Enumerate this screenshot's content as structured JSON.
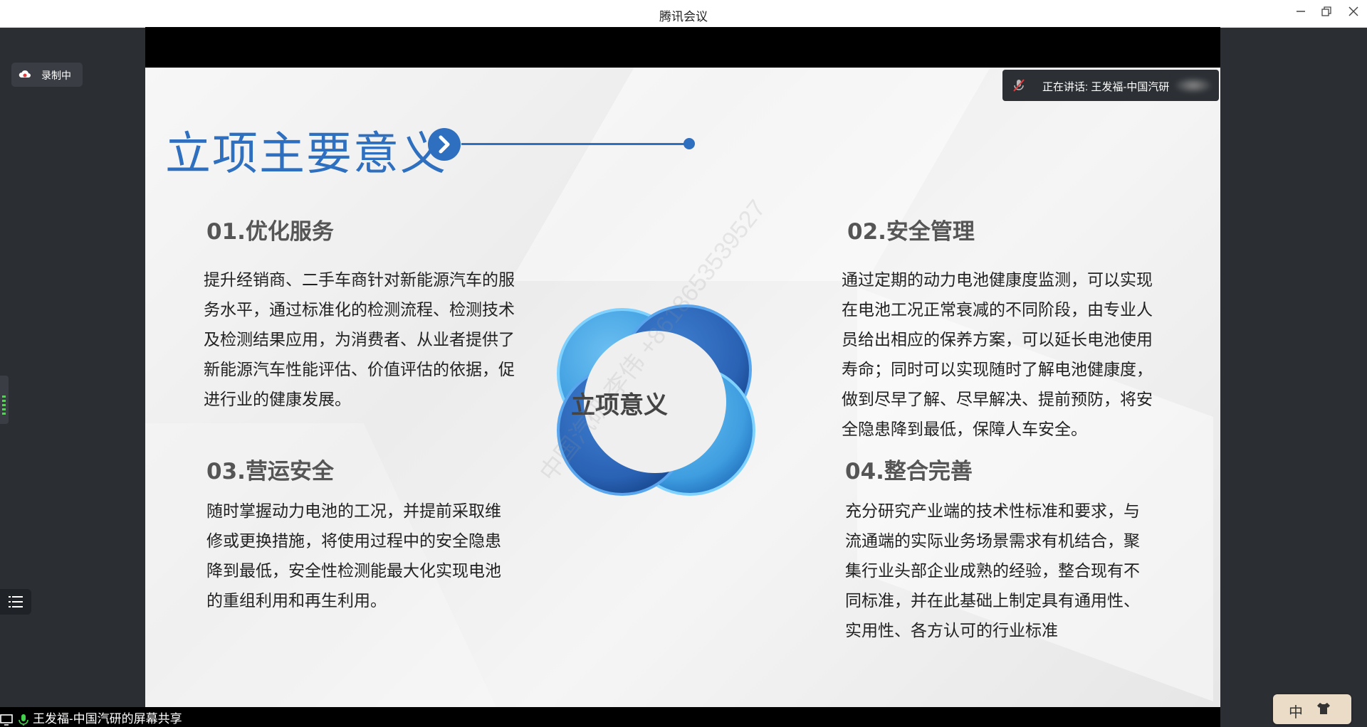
{
  "window": {
    "title": "腾讯会议"
  },
  "recording": {
    "label": "录制中"
  },
  "speaking": {
    "text": "正在讲话: 王发福-中国汽研"
  },
  "share": {
    "label": "王发福-中国汽研的屏幕共享"
  },
  "ime": {
    "char": "中"
  },
  "slide": {
    "title": "立项主要意义",
    "center": "立项意义",
    "watermark": "中国汽研-李伟 +8618653539527",
    "sections": [
      {
        "heading": "01.优化服务",
        "body": "提升经销商、二手车商针对新能源汽车的服务水平，通过标准化的检测流程、检测技术及检测结果应用，为消费者、从业者提供了新能源汽车性能评估、价值评估的依据，促进行业的健康发展。"
      },
      {
        "heading": "02.安全管理",
        "body": "通过定期的动力电池健康度监测，可以实现在电池工况正常衰减的不同阶段，由专业人员给出相应的保养方案，可以延长电池使用寿命；同时可以实现随时了解电池健康度，做到尽早了解、尽早解决、提前预防，将安全隐患降到最低，保障人车安全。"
      },
      {
        "heading": "03.营运安全",
        "body": "随时掌握动力电池的工况，并提前采取维修或更换措施，将使用过程中的安全隐患降到最低，安全性检测能最大化实现电池的重组利用和再生利用。"
      },
      {
        "heading": "04.整合完善",
        "body": "充分研究产业端的技术性标准和要求，与流通端的实际业务场景需求有机结合，聚集行业头部企业成熟的经验，整合现有不同标准，并在此基础上制定具有通用性、实用性、各方认可的行业标准"
      }
    ]
  },
  "colors": {
    "accent": "#2f6fbf",
    "circle_light": "#4aa8e8",
    "circle_dark": "#2a66b8"
  }
}
